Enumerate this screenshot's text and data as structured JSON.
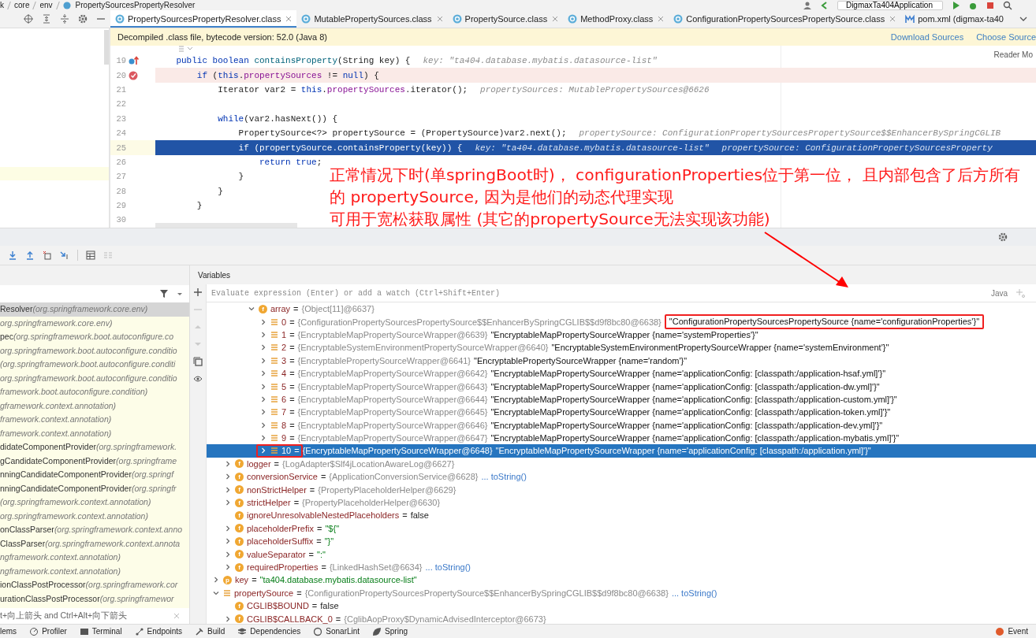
{
  "breadcrumbs": [
    "k",
    "core",
    "env",
    "PropertySourcesPropertyResolver"
  ],
  "run_config": {
    "label": "DigmaxTa404Application"
  },
  "tabs": [
    {
      "label": "PropertySourcesPropertyResolver.class",
      "kind": "class",
      "selected": true,
      "closable": true
    },
    {
      "label": "MutablePropertySources.class",
      "kind": "class",
      "selected": false,
      "closable": true
    },
    {
      "label": "PropertySource.class",
      "kind": "class",
      "selected": false,
      "closable": true
    },
    {
      "label": "MethodProxy.class",
      "kind": "class",
      "selected": false,
      "closable": true
    },
    {
      "label": "ConfigurationPropertySourcesPropertySource.class",
      "kind": "class",
      "selected": false,
      "closable": true
    },
    {
      "label": "pom.xml (digmax-ta40",
      "kind": "maven",
      "selected": false,
      "closable": false
    }
  ],
  "infobar": {
    "message": "Decompiled .class file, bytecode version: 52.0 (Java 8)",
    "actions": [
      "Download Sources",
      "Choose Source"
    ]
  },
  "editor": {
    "reader_mode": "Reader Mo",
    "lines": [
      {
        "number": "19",
        "kind": "method-breakpoint",
        "segments": [
          {
            "text": "    public boolean ",
            "kind": "keyword"
          },
          {
            "text": "containsProperty",
            "kind": "declaration"
          },
          {
            "text": "(String key) {",
            "kind": "plain"
          }
        ],
        "hints": [
          "key: \"ta404.database.mybatis.datasource-list\""
        ]
      },
      {
        "number": "20",
        "kind": "breakpoint",
        "segments": [
          {
            "text": "        if",
            "kind": "keyword"
          },
          {
            "text": " (",
            "kind": "plain"
          },
          {
            "text": "this",
            "kind": "keyword"
          },
          {
            "text": ".",
            "kind": "plain"
          },
          {
            "text": "propertySources",
            "kind": "field"
          },
          {
            "text": " != ",
            "kind": "plain"
          },
          {
            "text": "null",
            "kind": "keyword"
          },
          {
            "text": ") {",
            "kind": "plain"
          }
        ]
      },
      {
        "number": "21",
        "kind": "plain",
        "segments": [
          {
            "text": "            Iterator var2 = ",
            "kind": "plain"
          },
          {
            "text": "this",
            "kind": "keyword"
          },
          {
            "text": ".",
            "kind": "plain"
          },
          {
            "text": "propertySources",
            "kind": "field"
          },
          {
            "text": ".iterator();",
            "kind": "plain"
          }
        ],
        "hints": [
          "propertySources: MutablePropertySources@6626"
        ]
      },
      {
        "number": "22",
        "kind": "plain"
      },
      {
        "number": "23",
        "kind": "plain",
        "segments": [
          {
            "text": "            while",
            "kind": "keyword"
          },
          {
            "text": "(var2.hasNext()) {",
            "kind": "plain"
          }
        ]
      },
      {
        "number": "24",
        "kind": "plain",
        "segments": [
          {
            "text": "                PropertySource<?> propertySource = (PropertySource)var2.next();",
            "kind": "plain"
          }
        ],
        "hints": [
          "propertySource: ConfigurationPropertySourcesPropertySource$$EnhancerBySpringCGLIB"
        ]
      },
      {
        "number": "25",
        "kind": "current",
        "segments": [
          {
            "text": "                if",
            "kind": "keyword"
          },
          {
            "text": " (propertySource.containsProperty(key)) {",
            "kind": "plain"
          }
        ],
        "hints": [
          "key: \"ta404.database.mybatis.datasource-list\"",
          "propertySource: ConfigurationPropertySourcesProperty"
        ]
      },
      {
        "number": "26",
        "kind": "plain",
        "segments": [
          {
            "text": "                    return true",
            "kind": "keyword"
          },
          {
            "text": ";",
            "kind": "plain"
          }
        ]
      },
      {
        "number": "27",
        "kind": "plain",
        "segments": [
          {
            "text": "                }",
            "kind": "plain"
          }
        ]
      },
      {
        "number": "28",
        "kind": "plain",
        "segments": [
          {
            "text": "            }",
            "kind": "plain"
          }
        ]
      },
      {
        "number": "29",
        "kind": "plain",
        "segments": [
          {
            "text": "        }",
            "kind": "plain"
          }
        ]
      },
      {
        "number": "30",
        "kind": "plain"
      }
    ]
  },
  "annotation": [
    "正常情况下时(单springBoot时)， configurationProperties位于第一位， 且内部包含了后方所有的 propertySource, 因为是他们的动态代理实现",
    "可用于宽松获取属性 (其它的propertySource无法实现该功能)"
  ],
  "frames": [
    {
      "method": "Resolver",
      "package": "(org.springframework.core.env)",
      "selected": true
    },
    {
      "package": "org.springframework.core.env)",
      "selected": false
    },
    {
      "method": "pec",
      "package": "(org.springframework.boot.autoconfigure.co",
      "selected": false
    },
    {
      "package": "org.springframework.boot.autoconfigure.conditio",
      "selected": false
    },
    {
      "package": "(org.springframework.boot.autoconfigure.conditi",
      "selected": false
    },
    {
      "package": "org.springframework.boot.autoconfigure.conditio",
      "selected": false
    },
    {
      "package": "framework.boot.autoconfigure.condition)",
      "selected": false
    },
    {
      "package": "gframework.context.annotation)",
      "selected": false
    },
    {
      "package": "framework.context.annotation)",
      "selected": false
    },
    {
      "package": "framework.context.annotation)",
      "selected": false
    },
    {
      "method": "didateComponentProvider",
      "package": "(org.springframework.",
      "selected": false
    },
    {
      "method": "gCandidateComponentProvider",
      "package": "(org.springframe",
      "selected": false
    },
    {
      "method": "nningCandidateComponentProvider",
      "package": "(org.springf",
      "selected": false
    },
    {
      "method": "nningCandidateComponentProvider",
      "package": "(org.springfr",
      "selected": false
    },
    {
      "package": "(org.springframework.context.annotation)",
      "selected": false
    },
    {
      "package": "org.springframework.context.annotation)",
      "selected": false
    },
    {
      "method": "onClassParser",
      "package": "(org.springframework.context.anno",
      "selected": false
    },
    {
      "method": "ClassParser",
      "package": "(org.springframework.context.annota",
      "selected": false
    },
    {
      "package": "ngframework.context.annotation)",
      "selected": false
    },
    {
      "package": "ngframework.context.annotation)",
      "selected": false
    },
    {
      "method": "ionClassPostProcessor",
      "package": "(org.springframework.cor",
      "selected": false
    },
    {
      "method": "urationClassPostProcessor",
      "package": "(org.springframewor",
      "selected": false
    }
  ],
  "frames_hint": "t+向上箭头 and Ctrl+Alt+向下箭头",
  "variables": {
    "title": "Variables",
    "placeholder": "Evaluate expression (Enter) or add a watch (Ctrl+Shift+Enter)",
    "language": "Java",
    "tree": [
      {
        "children": [
          {
            "children": [
              {
                "children": [
                  {
                    "name": "array",
                    "op": "=",
                    "value": {
                      "text": "{Object[11]@6637}",
                      "kind": "reference"
                    },
                    "kind": "field",
                    "badge": "f",
                    "expanded": true,
                    "selected": false,
                    "children": [
                      {
                        "name": "0",
                        "op": "=",
                        "value": {
                          "text": "{ConfigurationPropertySourcesPropertySource$$EnhancerBySpringCGLIB$$d9f8bc80@6638}",
                          "kind": "reference"
                        },
                        "detail": "\"ConfigurationPropertySourcesPropertySource {name='configurationProperties'}\"",
                        "kind": "element",
                        "expanded": false,
                        "selected": false
                      },
                      {
                        "name": "1",
                        "op": "=",
                        "value": {
                          "text": "{EncryptableMapPropertySourceWrapper@6639}",
                          "kind": "reference"
                        },
                        "detail": "\"EncryptableMapPropertySourceWrapper {name='systemProperties'}\"",
                        "kind": "element",
                        "expanded": false,
                        "selected": false
                      },
                      {
                        "name": "2",
                        "op": "=",
                        "value": {
                          "text": "{EncryptableSystemEnvironmentPropertySourceWrapper@6640}",
                          "kind": "reference"
                        },
                        "detail": "\"EncryptableSystemEnvironmentPropertySourceWrapper {name='systemEnvironment'}\"",
                        "kind": "element",
                        "expanded": false,
                        "selected": false
                      },
                      {
                        "name": "3",
                        "op": "=",
                        "value": {
                          "text": "{EncryptablePropertySourceWrapper@6641}",
                          "kind": "reference"
                        },
                        "detail": "\"EncryptablePropertySourceWrapper {name='random'}\"",
                        "kind": "element",
                        "expanded": false,
                        "selected": false
                      },
                      {
                        "name": "4",
                        "op": "=",
                        "value": {
                          "text": "{EncryptableMapPropertySourceWrapper@6642}",
                          "kind": "reference"
                        },
                        "detail": "\"EncryptableMapPropertySourceWrapper {name='applicationConfig: [classpath:/application-hsaf.yml]'}\"",
                        "kind": "element",
                        "expanded": false,
                        "selected": false
                      },
                      {
                        "name": "5",
                        "op": "=",
                        "value": {
                          "text": "{EncryptableMapPropertySourceWrapper@6643}",
                          "kind": "reference"
                        },
                        "detail": "\"EncryptableMapPropertySourceWrapper {name='applicationConfig: [classpath:/application-dw.yml]'}\"",
                        "kind": "element",
                        "expanded": false,
                        "selected": false
                      },
                      {
                        "name": "6",
                        "op": "=",
                        "value": {
                          "text": "{EncryptableMapPropertySourceWrapper@6644}",
                          "kind": "reference"
                        },
                        "detail": "\"EncryptableMapPropertySourceWrapper {name='applicationConfig: [classpath:/application-custom.yml]'}\"",
                        "kind": "element",
                        "expanded": false,
                        "selected": false
                      },
                      {
                        "name": "7",
                        "op": "=",
                        "value": {
                          "text": "{EncryptableMapPropertySourceWrapper@6645}",
                          "kind": "reference"
                        },
                        "detail": "\"EncryptableMapPropertySourceWrapper {name='applicationConfig: [classpath:/application-token.yml]'}\"",
                        "kind": "element",
                        "expanded": false,
                        "selected": false
                      },
                      {
                        "name": "8",
                        "op": "=",
                        "value": {
                          "text": "{EncryptableMapPropertySourceWrapper@6646}",
                          "kind": "reference"
                        },
                        "detail": "\"EncryptableMapPropertySourceWrapper {name='applicationConfig: [classpath:/application-dev.yml]'}\"",
                        "kind": "element",
                        "expanded": false,
                        "selected": false
                      },
                      {
                        "name": "9",
                        "op": "=",
                        "value": {
                          "text": "{EncryptableMapPropertySourceWrapper@6647}",
                          "kind": "reference"
                        },
                        "detail": "\"EncryptableMapPropertySourceWrapper {name='applicationConfig: [classpath:/application-mybatis.yml]'}\"",
                        "kind": "element",
                        "expanded": false,
                        "selected": false
                      },
                      {
                        "name": "10",
                        "op": "=",
                        "value": {
                          "text": "{EncryptableMapPropertySourceWrapper@6648}",
                          "kind": "reference"
                        },
                        "detail": "\"EncryptableMapPropertySourceWrapper {name='applicationConfig: [classpath:/application.yml]'}\"",
                        "kind": "element",
                        "expanded": false,
                        "selected": true
                      }
                    ]
                  }
                ]
              }
            ]
          },
          {
            "name": "logger",
            "op": "=",
            "value": {
              "text": "{LogAdapter$Slf4jLocationAwareLog@6627}",
              "kind": "reference"
            },
            "kind": "field",
            "badge": "f",
            "expanded": false,
            "selected": false
          },
          {
            "name": "conversionService",
            "op": "=",
            "value": {
              "text": "{ApplicationConversionService@6628}",
              "kind": "reference"
            },
            "link": "... toString()",
            "kind": "field",
            "badge": "f",
            "expanded": false,
            "selected": false
          },
          {
            "name": "nonStrictHelper",
            "op": "=",
            "value": {
              "text": "{PropertyPlaceholderHelper@6629}",
              "kind": "reference"
            },
            "kind": "field",
            "badge": "f",
            "expanded": false,
            "selected": false
          },
          {
            "name": "strictHelper",
            "op": "=",
            "value": {
              "text": "{PropertyPlaceholderHelper@6630}",
              "kind": "reference"
            },
            "kind": "field",
            "badge": "f",
            "expanded": false,
            "selected": false
          },
          {
            "name": "ignoreUnresolvableNestedPlaceholders",
            "op": "=",
            "value": {
              "text": "false",
              "kind": "literal"
            },
            "kind": "field",
            "badge": "f",
            "selected": false
          },
          {
            "name": "placeholderPrefix",
            "op": "=",
            "value": {
              "text": "\"${\"",
              "kind": "string"
            },
            "kind": "field",
            "badge": "f",
            "expanded": false,
            "selected": false
          },
          {
            "name": "placeholderSuffix",
            "op": "=",
            "value": {
              "text": "\"}\"",
              "kind": "string"
            },
            "kind": "field",
            "badge": "f",
            "expanded": false,
            "selected": false
          },
          {
            "name": "valueSeparator",
            "op": "=",
            "value": {
              "text": "\":\"",
              "kind": "string"
            },
            "kind": "field",
            "badge": "f",
            "expanded": false,
            "selected": false
          },
          {
            "name": "requiredProperties",
            "op": "=",
            "value": {
              "text": "{LinkedHashSet@6634}",
              "kind": "reference"
            },
            "link": "... toString()",
            "kind": "field",
            "badge": "f",
            "expanded": false,
            "selected": false
          }
        ]
      },
      {
        "name": "key",
        "op": "=",
        "value": {
          "text": "\"ta404.database.mybatis.datasource-list\"",
          "kind": "string"
        },
        "kind": "parameter",
        "badge": "p",
        "expanded": false,
        "selected": false
      },
      {
        "name": "propertySource",
        "op": "=",
        "value": {
          "text": "{ConfigurationPropertySourcesPropertySource$$EnhancerBySpringCGLIB$$d9f8bc80@6638}",
          "kind": "reference"
        },
        "link": "... toString()",
        "kind": "element",
        "expanded": true,
        "selected": false,
        "children": [
          {
            "name": "CGLIB$BOUND",
            "op": "=",
            "value": {
              "text": "false",
              "kind": "literal"
            },
            "kind": "field",
            "badge": "f",
            "selected": false
          },
          {
            "name": "CGLIB$CALLBACK_0",
            "op": "=",
            "value": {
              "text": "{CglibAopProxy$DynamicAdvisedInterceptor@6673}",
              "kind": "reference"
            },
            "kind": "field",
            "badge": "f",
            "expanded": false,
            "selected": false
          }
        ]
      }
    ]
  },
  "status_bar": {
    "items": [
      {
        "label": "lems",
        "kind": "plain"
      },
      {
        "label": "Profiler",
        "kind": "profiler"
      },
      {
        "label": "Terminal",
        "kind": "terminal"
      },
      {
        "label": "Endpoints",
        "kind": "endpoints"
      },
      {
        "label": "Build",
        "kind": "build"
      },
      {
        "label": "Dependencies",
        "kind": "dependencies"
      },
      {
        "label": "SonarLint",
        "kind": "sonar"
      },
      {
        "label": "Spring",
        "kind": "spring"
      }
    ],
    "right": {
      "label": "Event",
      "kind": "event"
    }
  }
}
